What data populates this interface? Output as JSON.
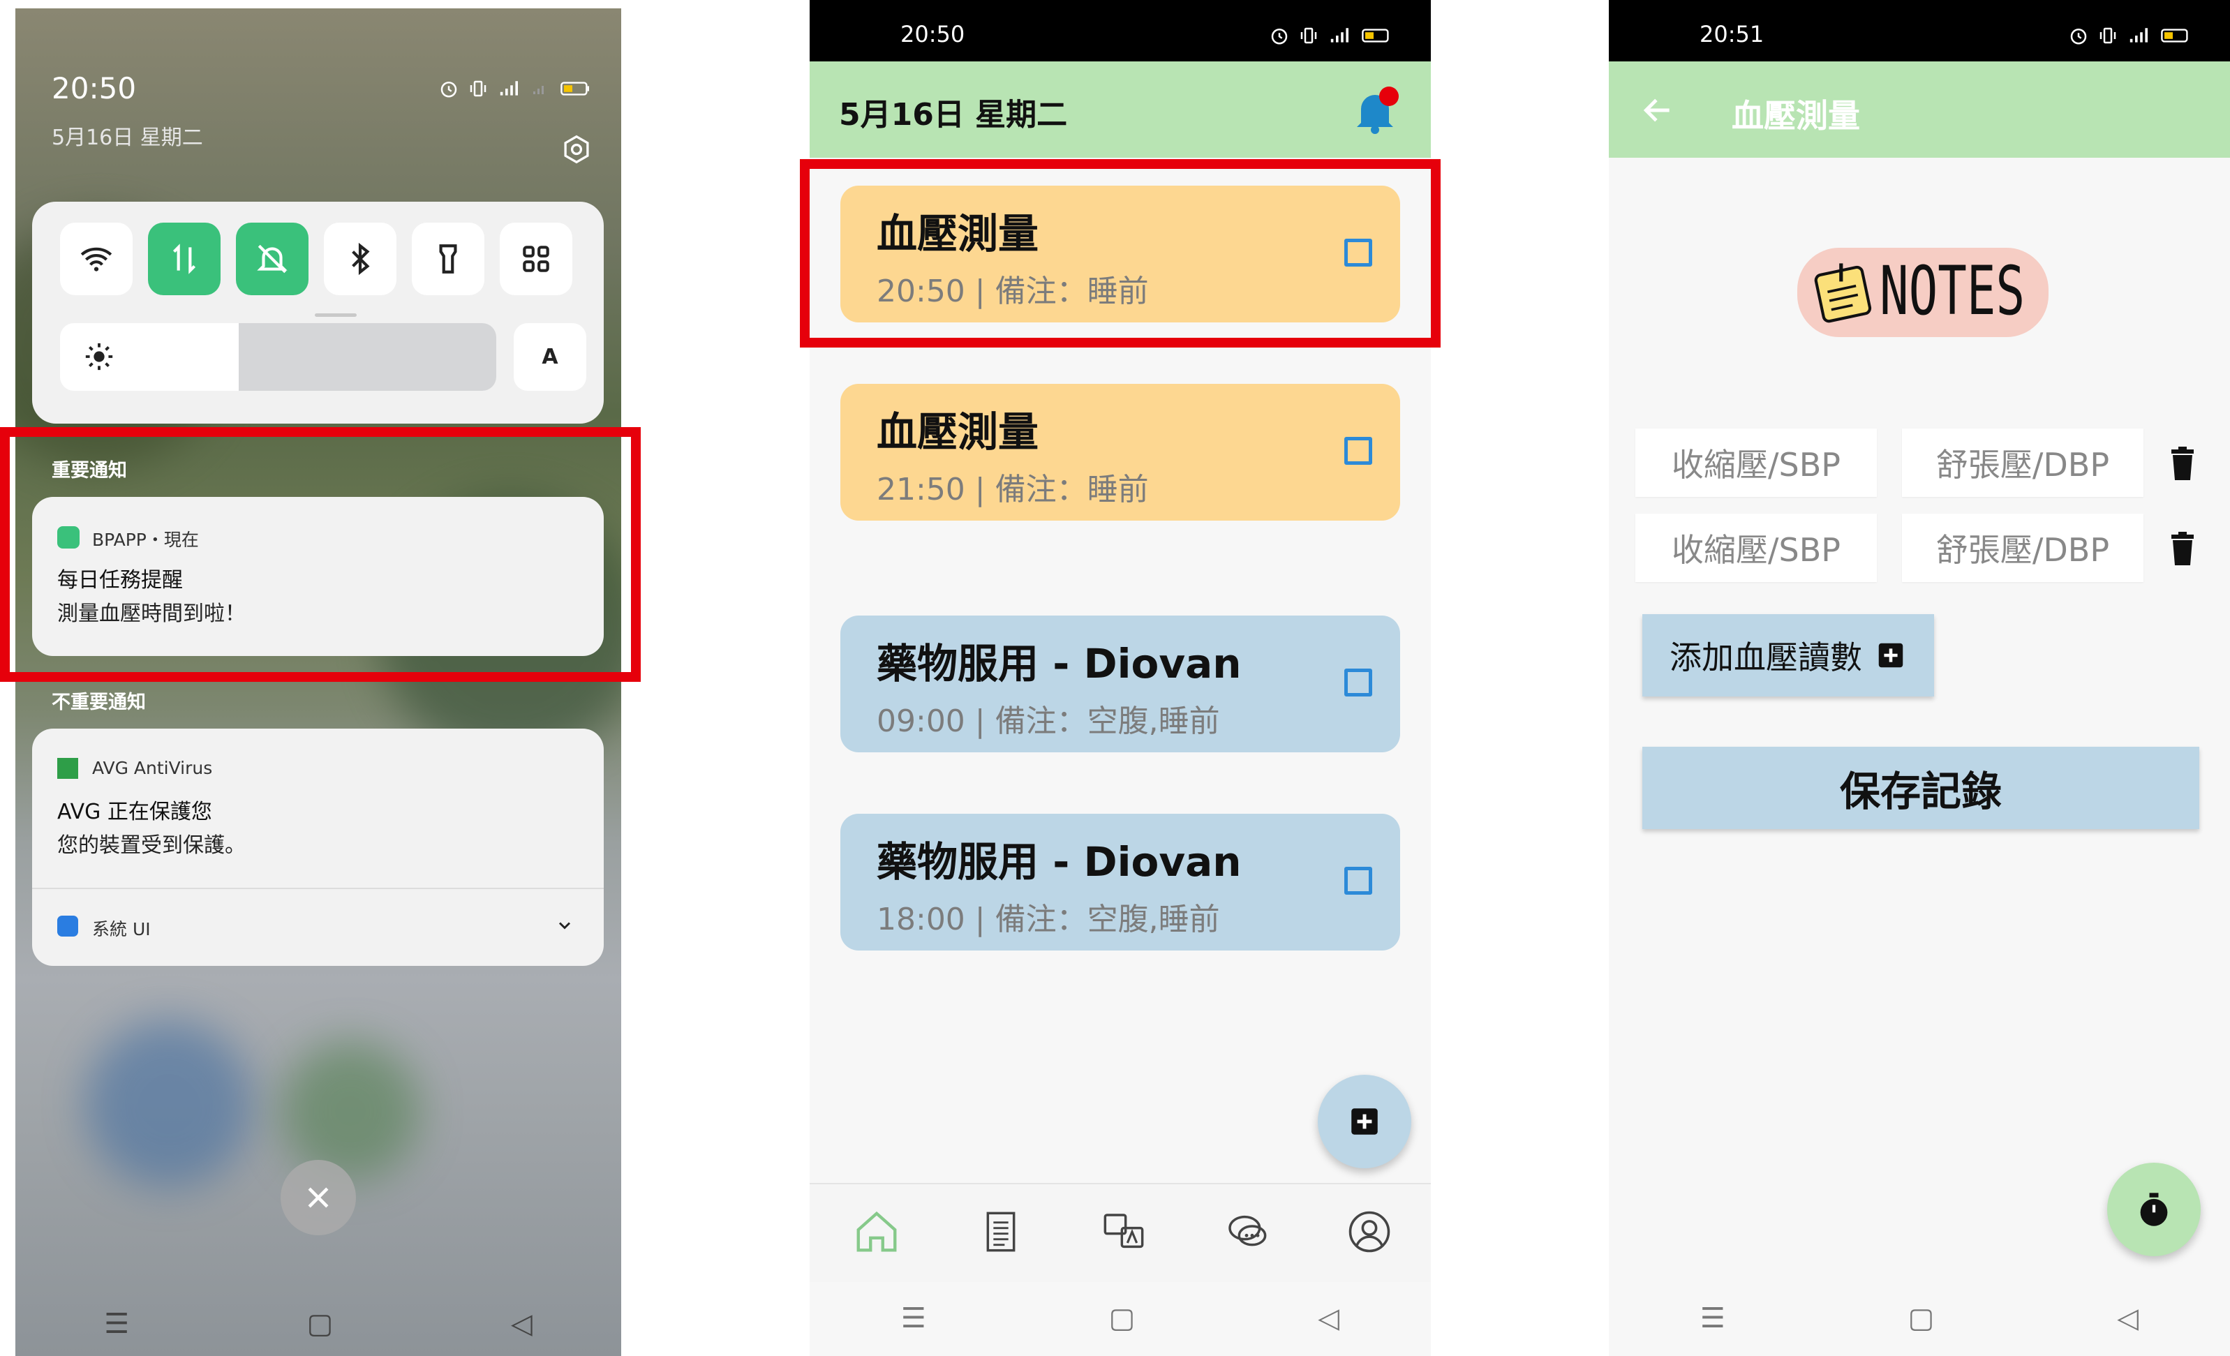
{
  "screen1": {
    "status": {
      "time": "20:50",
      "date": "5月16日 星期二"
    },
    "quick_tiles": [
      "wifi-icon",
      "mobile-data-icon",
      "silent-bell-icon",
      "bluetooth-icon",
      "flashlight-icon",
      "apps-grid-icon"
    ],
    "brightness_font_label": "A",
    "important_section": "重要通知",
    "notification_bp": {
      "app": "BPAPP・現在",
      "title": "每日任務提醒",
      "body": "測量血壓時間到啦！"
    },
    "unimportant_section": "不重要通知",
    "notification_avg": {
      "app": "AVG AntiVirus",
      "title": "AVG 正在保護您",
      "body": "您的裝置受到保護。",
      "footer": "系統 UI"
    }
  },
  "screen2": {
    "status": {
      "time": "20:50"
    },
    "header": {
      "title": "5月16日 星期二"
    },
    "tasks": [
      {
        "title": "血壓測量",
        "subtitle": "20:50 | 備注：睡前",
        "color": "#fdd791"
      },
      {
        "title": "血壓測量",
        "subtitle": "21:50 | 備注：睡前",
        "color": "#fdd791"
      },
      {
        "title": "藥物服用 - Diovan",
        "subtitle": "09:00 | 備注：空腹,睡前",
        "color": "#bcd6e6"
      },
      {
        "title": "藥物服用 - Diovan",
        "subtitle": "18:00 | 備注：空腹,睡前",
        "color": "#bcd6e6"
      }
    ],
    "bottom_nav": [
      "home-icon",
      "document-icon",
      "translate-icon",
      "chat-icon",
      "profile-icon"
    ]
  },
  "screen3": {
    "status": {
      "time": "20:51"
    },
    "header": {
      "title": "血壓測量"
    },
    "logo_text": "NOTES",
    "fields": {
      "sbp_placeholder": "收縮壓/SBP",
      "dbp_placeholder": "舒張壓/DBP"
    },
    "add_button": "添加血壓讀數",
    "save_button": "保存記錄"
  },
  "colors": {
    "green_header": "#b8e4b3",
    "task_yellow": "#fdd791",
    "task_blue": "#bcd6e6",
    "toggle_green": "#3ac17b",
    "highlight_red": "#e6000b"
  }
}
